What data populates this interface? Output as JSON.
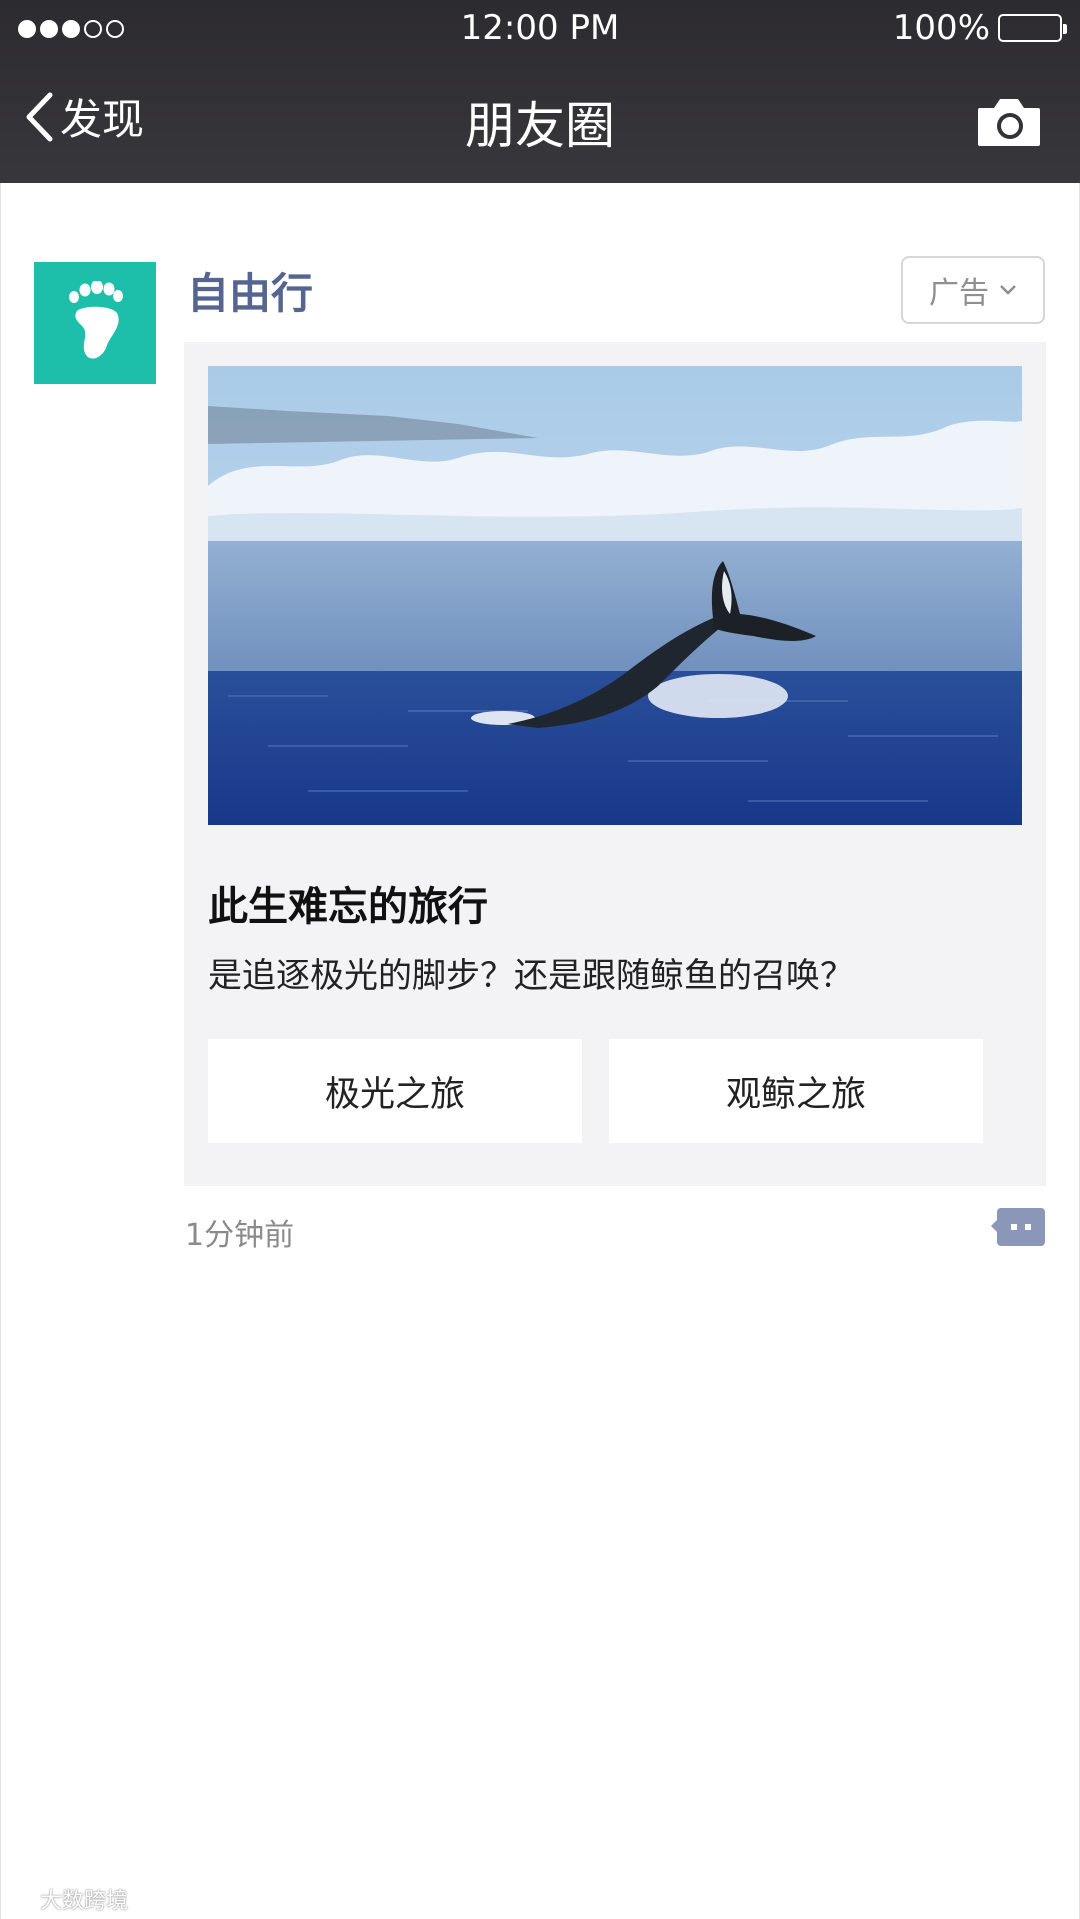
{
  "status_bar": {
    "time": "12:00 PM",
    "battery": "100%",
    "signal_bars": 3,
    "signal_total": 5
  },
  "nav": {
    "back_label": "发现",
    "title": "朋友圈",
    "camera_icon": "camera-icon"
  },
  "post": {
    "author": "自由行",
    "avatar_icon": "footprint-icon",
    "avatar_color": "#1dbfab",
    "ad_label": "广告",
    "card": {
      "image": "whale-tail-photo",
      "title": "此生难忘的旅行",
      "description": "是追逐极光的脚步？还是跟随鲸鱼的召唤？",
      "options": [
        "极光之旅",
        "观鲸之旅"
      ]
    },
    "time_ago": "1分钟前",
    "comment_icon": "comment-icon"
  },
  "watermark": {
    "text": "大数跨境"
  },
  "colors": {
    "nav_bg": "#2c2b30",
    "author_name": "#56658f",
    "card_bg": "#f3f3f5"
  }
}
